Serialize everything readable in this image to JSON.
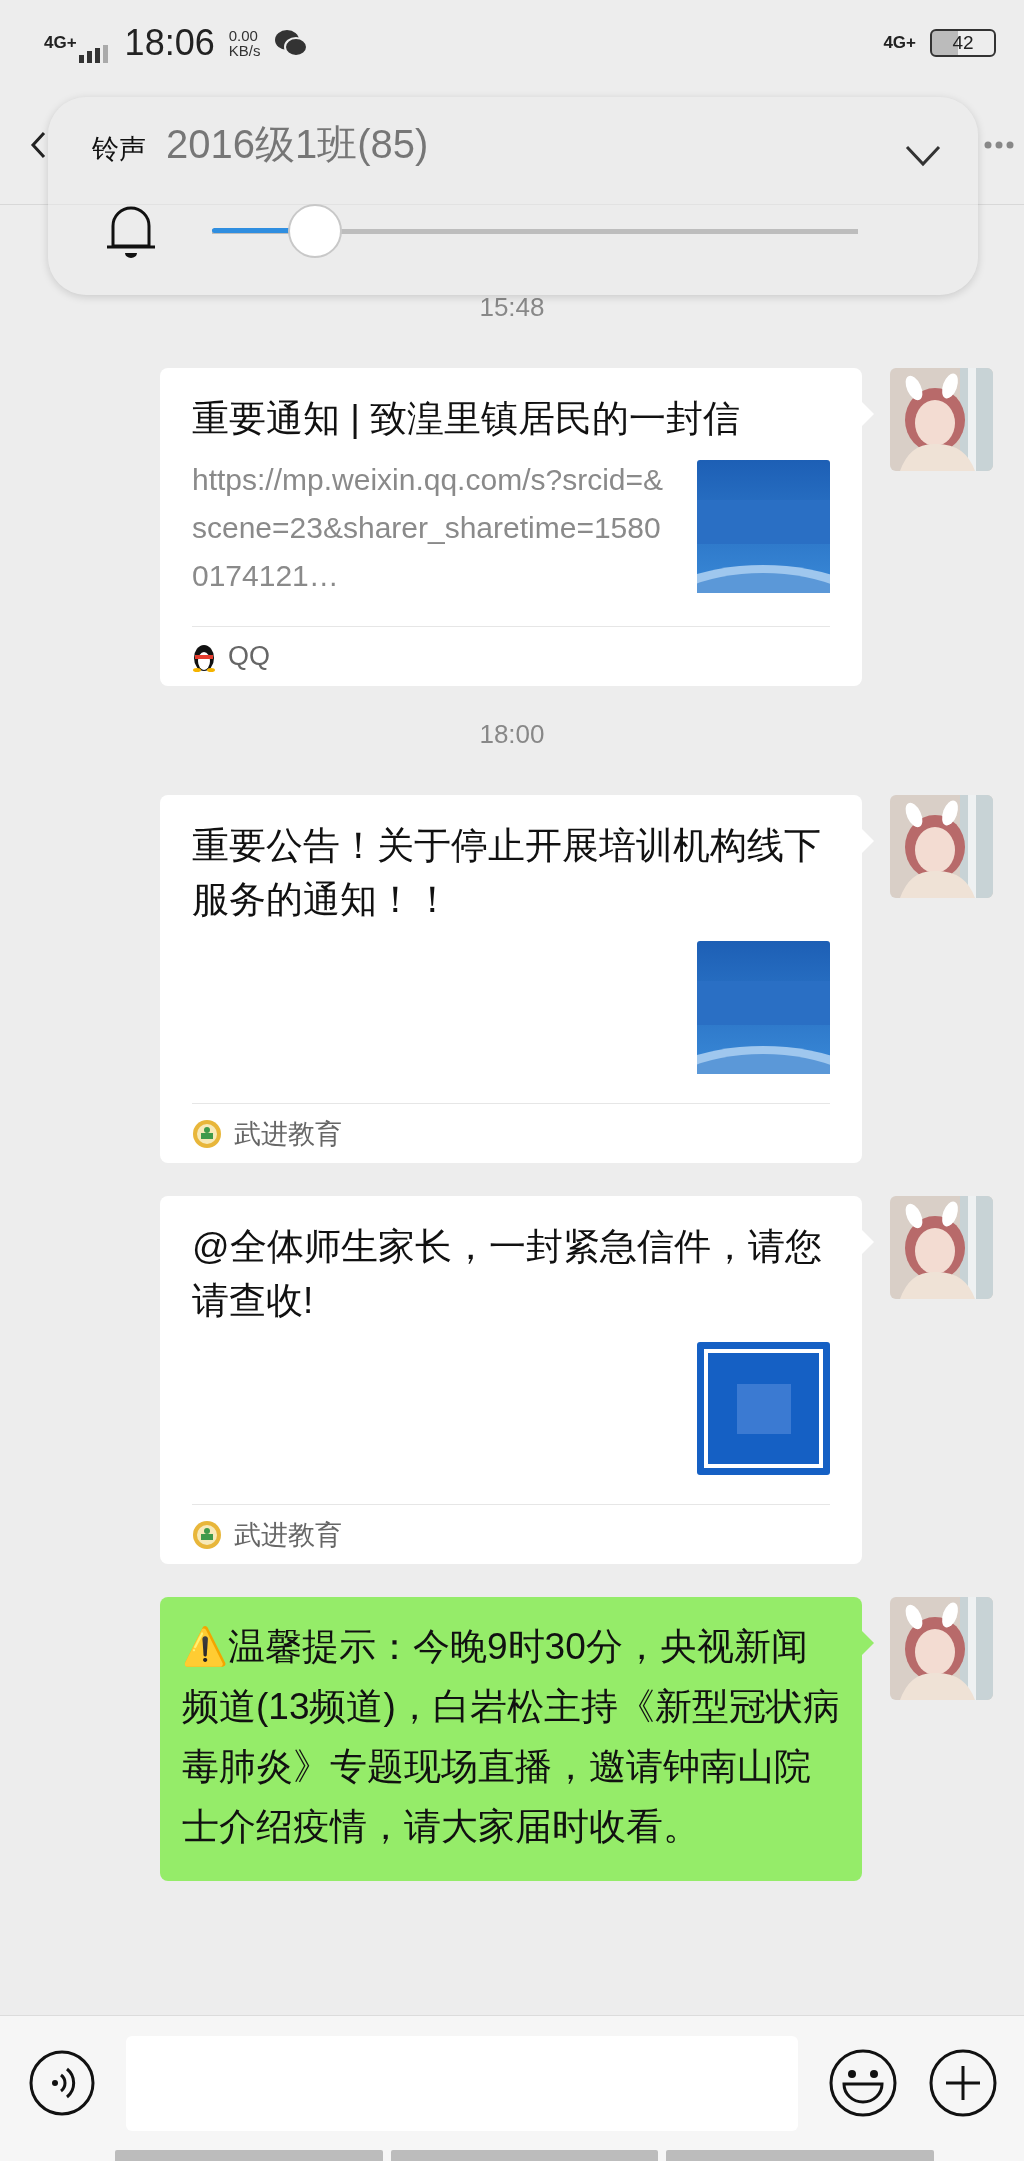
{
  "status_bar": {
    "network_left": "4G+",
    "time": "18:06",
    "speed_value": "0.00",
    "speed_unit": "KB/s",
    "network_right": "4G+",
    "battery": "42"
  },
  "header": {
    "title": "2016级1班(85)"
  },
  "volume_panel": {
    "label": "铃声",
    "level": 0.16,
    "expanded": false
  },
  "messages": [
    {
      "kind": "time",
      "text": "15:48"
    },
    {
      "kind": "link",
      "title": "重要通知 | 致湟里镇居民的一封信",
      "description": "https://mp.weixin.qq.com/s?srcid=&scene=23&sharer_sharetime=15800174121…",
      "thumbnail": {
        "kind": "globe"
      },
      "source": {
        "kind": "qq",
        "text": "QQ"
      }
    },
    {
      "kind": "time",
      "text": "18:00"
    },
    {
      "kind": "link",
      "title": "重要公告！关于停止开展培训机构线下服务的通知！！",
      "thumbnail": {
        "kind": "globe"
      },
      "source": {
        "kind": "account",
        "text": "武进教育"
      }
    },
    {
      "kind": "link",
      "title": "@全体师生家长，一封紧急信件，请您请查收!",
      "thumbnail": {
        "kind": "letter"
      },
      "source": {
        "kind": "account",
        "text": "武进教育"
      }
    },
    {
      "kind": "text",
      "text": "⚠️温馨提示：今晚9时30分，央视新闻频道(13频道)，白岩松主持《新型冠状病毒肺炎》专题现场直播，邀请钟南山院士介绍疫情，请大家届时收看。"
    }
  ]
}
